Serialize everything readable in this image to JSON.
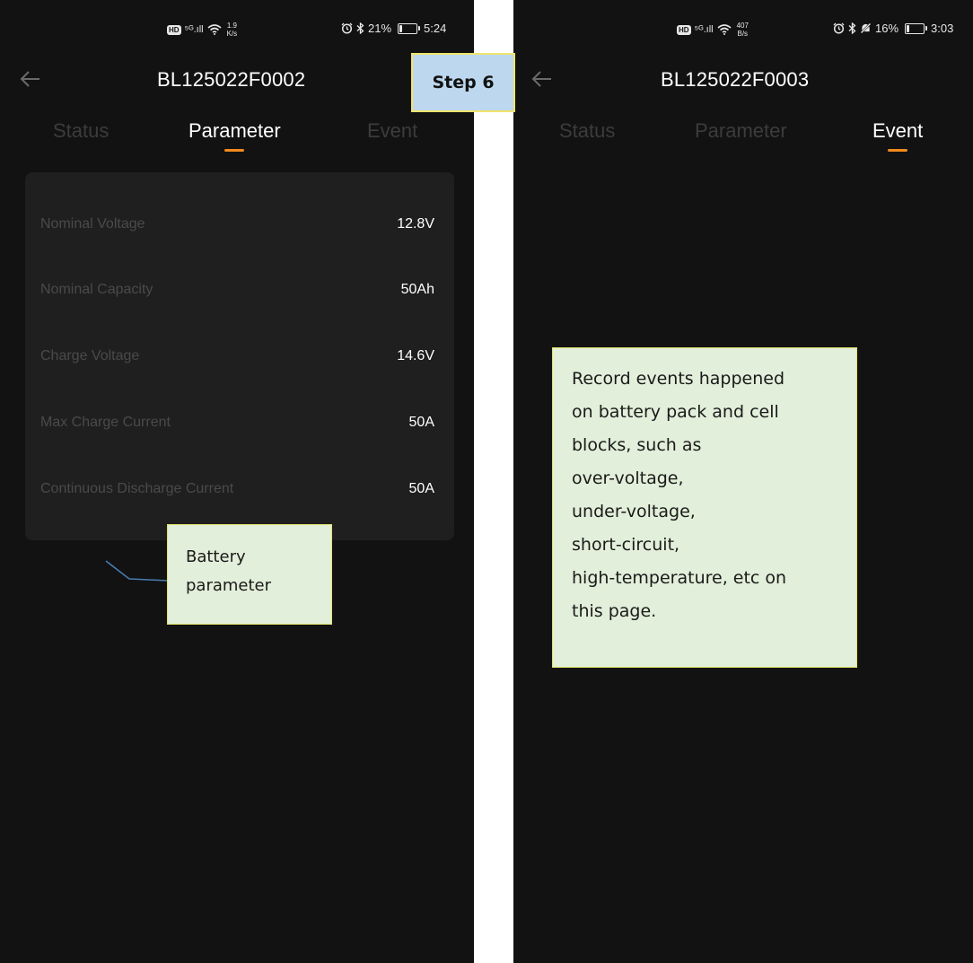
{
  "step_label": "Step 6",
  "left_screen": {
    "status_bar": {
      "hd": "HD",
      "signal": "⁵ᴳ.ıll",
      "net_speed_value": "1.9",
      "net_speed_unit": "K/s",
      "battery_percent": "21%",
      "battery_level": 0.21,
      "time": "5:24"
    },
    "title": "BL125022F0002",
    "tabs": [
      {
        "label": "Status",
        "active": false
      },
      {
        "label": "Parameter",
        "active": true
      },
      {
        "label": "Event",
        "active": false
      }
    ],
    "parameters": [
      {
        "label": "Nominal Voltage",
        "value": "12.8V"
      },
      {
        "label": "Nominal Capacity",
        "value": "50Ah"
      },
      {
        "label": "Charge Voltage",
        "value": "14.6V"
      },
      {
        "label": "Max Charge Current",
        "value": "50A"
      },
      {
        "label": "Continuous Discharge Current",
        "value": "50A"
      }
    ],
    "callout_lines": [
      "Battery",
      "parameter"
    ]
  },
  "right_screen": {
    "status_bar": {
      "hd": "HD",
      "signal": "⁵ᴳ.ıll",
      "net_speed_value": "407",
      "net_speed_unit": "B/s",
      "battery_percent": "16%",
      "battery_level": 0.16,
      "time": "3:03"
    },
    "title": "BL125022F0003",
    "tabs": [
      {
        "label": "Status",
        "active": false
      },
      {
        "label": "Parameter",
        "active": false
      },
      {
        "label": "Event",
        "active": true
      }
    ],
    "callout_lines": [
      "Record events happened",
      "on battery pack and cell",
      "blocks, such as",
      "over-voltage,",
      "under-voltage,",
      "short-circuit,",
      "high-temperature, etc on",
      "this page."
    ]
  },
  "colors": {
    "background": "#121212",
    "card": "#1f1f1f",
    "accent": "#f28a1e",
    "callout": "#e2efda",
    "step_label": "#bdd7ee"
  },
  "icons": [
    "back-arrow-icon",
    "wifi-icon",
    "alarm-icon",
    "bluetooth-icon",
    "bell-muted-icon",
    "battery-icon"
  ]
}
